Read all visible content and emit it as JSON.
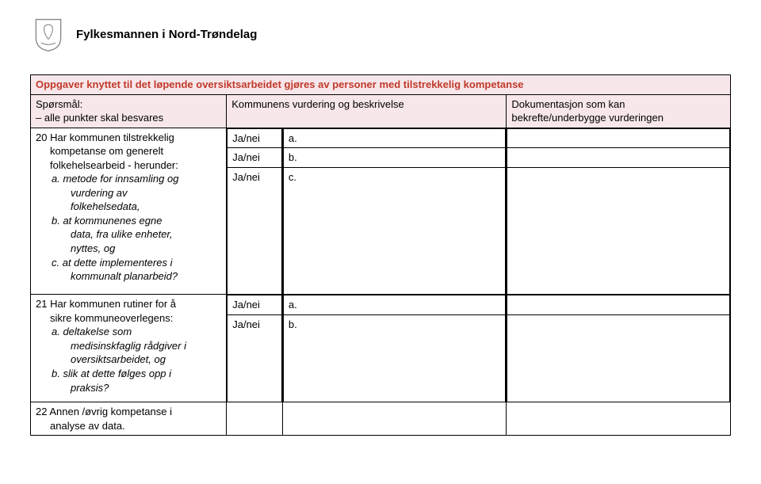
{
  "header": {
    "org_name": "Fylkesmannen i Nord-Trøndelag"
  },
  "section_title": "Oppgaver knyttet til det løpende oversiktsarbeidet gjøres av personer med tilstrekkelig kompetanse",
  "columns": {
    "question_label": "Spørsmål:",
    "question_sub": "– alle punkter skal besvares",
    "assessment": "Kommunens vurdering og beskrivelse",
    "documentation_line1": "Dokumentasjon som kan",
    "documentation_line2": "bekrefte/underbygge vurderingen"
  },
  "answer_option": "Ja/nei",
  "letters": {
    "a": "a.",
    "b": "b.",
    "c": "c."
  },
  "q20": {
    "lead_line1": "20 Har kommunen tilstrekkelig",
    "lead_line2": "kompetanse om generelt",
    "lead_line3": "folkehelsearbeid - herunder:",
    "a1": "a. metode for innsamling og",
    "a2": "vurdering av",
    "a3": "folkehelsedata,",
    "b1": "b. at kommunenes egne",
    "b2": "data, fra ulike enheter,",
    "b3": "nyttes, og",
    "c1": "c. at dette implementeres i",
    "c2": "kommunalt planarbeid?"
  },
  "q21": {
    "lead_line1": "21 Har kommunen rutiner for å",
    "lead_line2": "sikre kommuneoverlegens:",
    "a1": "a. deltakelse som",
    "a2": "medisinskfaglig rådgiver i",
    "a3": "oversiktsarbeidet, og",
    "b1": "b. slik at dette følges opp i",
    "b2": "praksis?"
  },
  "q22": {
    "line1": "22 Annen /øvrig kompetanse i",
    "line2": "analyse av data."
  }
}
